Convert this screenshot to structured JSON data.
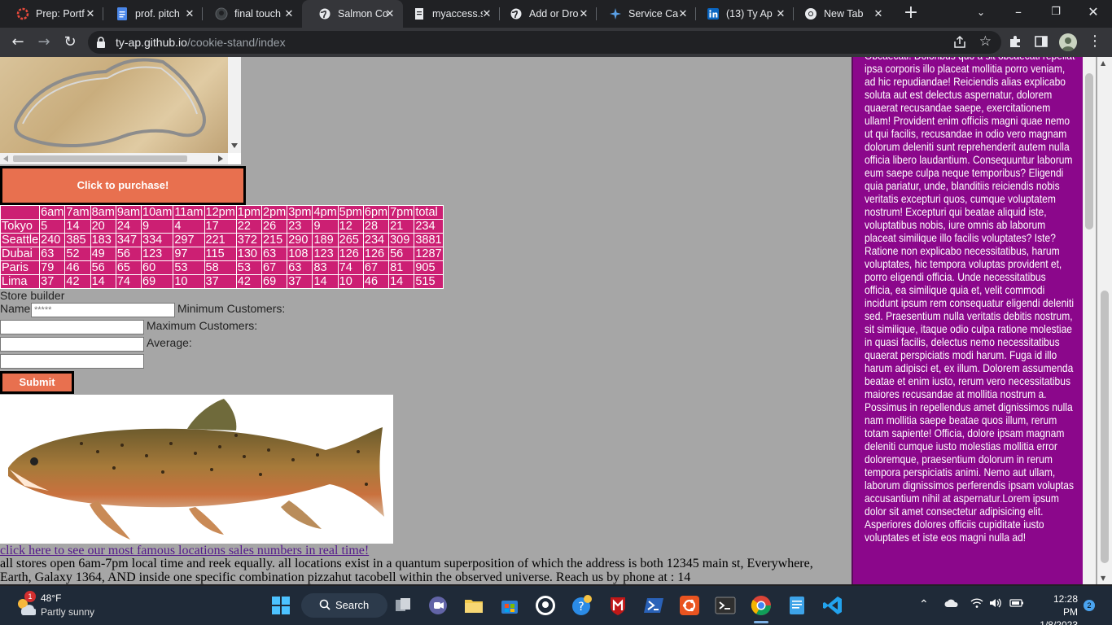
{
  "tabs": [
    {
      "title": "Prep: Portf",
      "icon": "red-ring-icon",
      "active": false
    },
    {
      "title": "prof. pitch",
      "icon": "google-docs-icon",
      "active": false
    },
    {
      "title": "final touch",
      "icon": "github-icon",
      "active": false
    },
    {
      "title": "Salmon Co",
      "icon": "globe-icon",
      "active": true
    },
    {
      "title": "myaccess.s",
      "icon": "doc-icon",
      "active": false
    },
    {
      "title": "Add or Dro",
      "icon": "globe-icon",
      "active": false
    },
    {
      "title": "Service Ca",
      "icon": "star-logo-icon",
      "active": false
    },
    {
      "title": "(13) Ty Ap",
      "icon": "linkedin-icon",
      "active": false
    },
    {
      "title": "New Tab",
      "icon": "chrome-icon",
      "active": false
    }
  ],
  "address": {
    "host": "ty-ap.github.io",
    "path": "/cookie-stand/index"
  },
  "page": {
    "purchase_label": "Click to purchase!",
    "table": {
      "headers": [
        "",
        "6am",
        "7am",
        "8am",
        "9am",
        "10am",
        "11am",
        "12pm",
        "1pm",
        "2pm",
        "3pm",
        "4pm",
        "5pm",
        "6pm",
        "7pm",
        "total"
      ],
      "rows": [
        [
          "Tokyo",
          "5",
          "14",
          "20",
          "24",
          "9",
          "4",
          "17",
          "22",
          "26",
          "23",
          "9",
          "12",
          "28",
          "21",
          "234"
        ],
        [
          "Seattle",
          "240",
          "385",
          "183",
          "347",
          "334",
          "297",
          "221",
          "372",
          "215",
          "290",
          "189",
          "265",
          "234",
          "309",
          "3881"
        ],
        [
          "Dubai",
          "63",
          "52",
          "49",
          "56",
          "123",
          "97",
          "115",
          "130",
          "63",
          "108",
          "123",
          "126",
          "126",
          "56",
          "1287"
        ],
        [
          "Paris",
          "79",
          "46",
          "56",
          "65",
          "60",
          "53",
          "58",
          "53",
          "67",
          "63",
          "83",
          "74",
          "67",
          "81",
          "905"
        ],
        [
          "Lima",
          "37",
          "42",
          "14",
          "74",
          "69",
          "10",
          "37",
          "42",
          "69",
          "37",
          "14",
          "10",
          "46",
          "14",
          "515"
        ]
      ]
    },
    "form": {
      "title": "Store builder",
      "name_label": "Name:",
      "name_placeholder": "*****",
      "min_label": "Minimum Customers:",
      "max_label": "Maximum Customers:",
      "avg_label": "Average:",
      "submit_label": "Submit"
    },
    "sales_link": "click here to see our most famous locations sales numbers in real time!",
    "info_text": "all stores open 6am-7pm local time and reek equally. all locations exist in a quantum superposition of which the address is both 12345 main st, Everywhere, Earth, Galaxy 1364, AND inside one specific combination pizzahut tacobell within the observed universe. Reach us by phone at : 14",
    "aside_text": "Obcaecati! Doloribus quo a sit obcaecati repellat ipsa corporis illo placeat mollitia porro veniam, ad hic repudiandae! Reiciendis alias explicabo soluta aut est delectus aspernatur, dolorem quaerat recusandae saepe, exercitationem ullam! Provident enim officiis magni quae nemo ut qui facilis, recusandae in odio vero magnam dolorum deleniti sunt reprehenderit autem nulla officia libero laudantium. Consequuntur laborum eum saepe culpa neque temporibus? Eligendi quia pariatur, unde, blanditiis reiciendis nobis veritatis excepturi quos, cumque voluptatem nostrum! Excepturi qui beatae aliquid iste, voluptatibus nobis, iure omnis ab laborum placeat similique illo facilis voluptates? Iste? Ratione non explicabo necessitatibus, harum voluptates, hic tempora voluptas provident et, porro eligendi officia. Unde necessitatibus officia, ea similique quia et, velit commodi incidunt ipsum rem consequatur eligendi deleniti sed. Praesentium nulla veritatis debitis nostrum, sit similique, itaque odio culpa ratione molestiae in quasi facilis, delectus nemo necessitatibus quaerat perspiciatis modi harum. Fuga id illo harum adipisci et, ex illum. Dolorem assumenda beatae et enim iusto, rerum vero necessitatibus maiores recusandae at mollitia nostrum a. Possimus in repellendus amet dignissimos nulla nam mollitia saepe beatae quos illum, rerum totam sapiente! Officia, dolore ipsam magnam deleniti cumque iusto molestias mollitia error doloremque, praesentium dolorum in rerum tempora perspiciatis animi. Nemo aut ullam, laborum dignissimos perferendis ipsam voluptas accusantium nihil at aspernatur.Lorem ipsum dolor sit amet consectetur adipisicing elit. Asperiores dolores officiis cupiditate iusto voluptates et iste eos magni nulla ad!"
  },
  "taskbar": {
    "weather_temp": "48°F",
    "weather_desc": "Partly sunny",
    "weather_badge": "1",
    "search_label": "Search",
    "time": "12:28 PM",
    "date": "1/8/2023",
    "notifications": "2"
  },
  "colors": {
    "table_bg": "#cc1f73",
    "button_bg": "#e8704f",
    "aside_bg": "#8b078b",
    "page_bg": "#a6a6a6"
  }
}
